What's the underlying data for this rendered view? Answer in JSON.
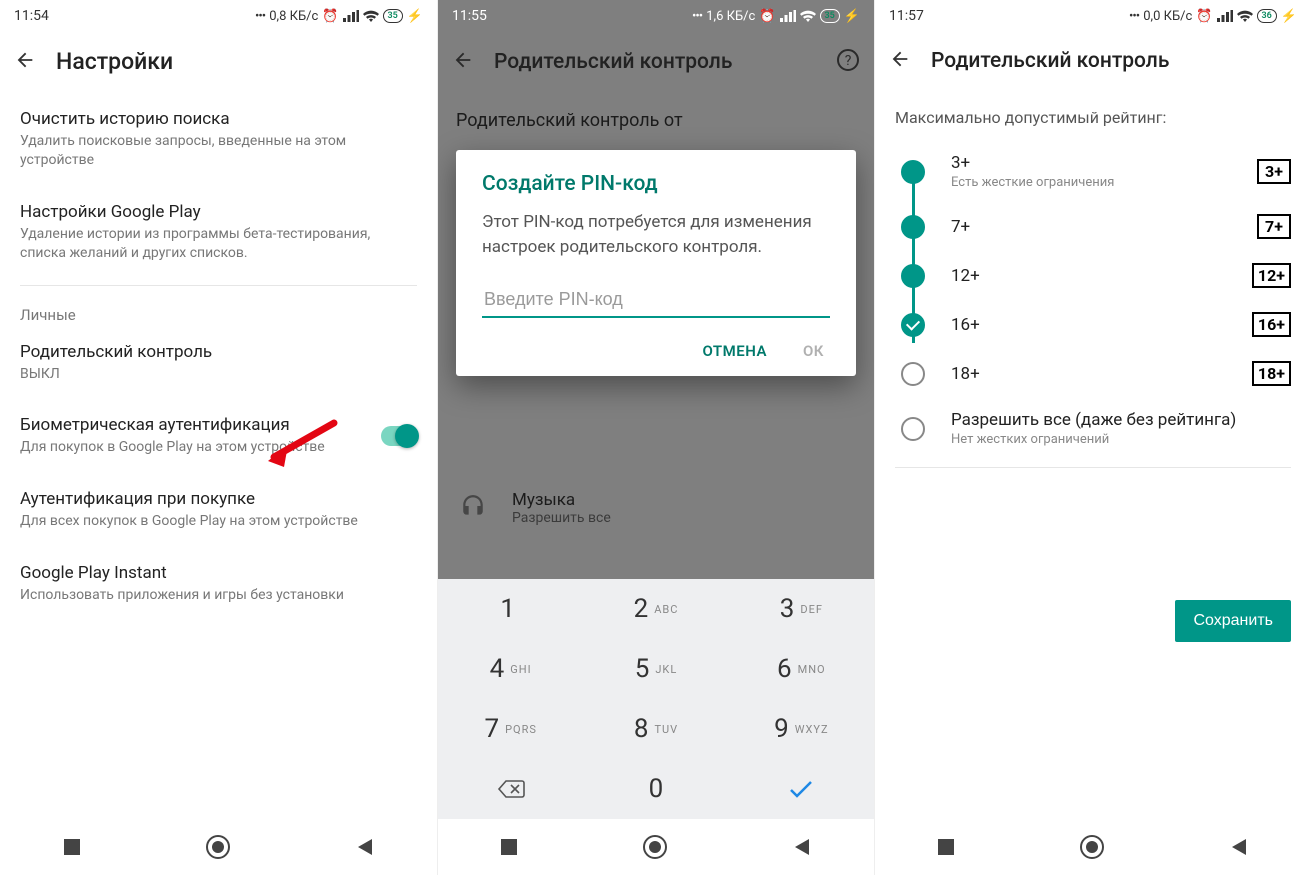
{
  "phone1": {
    "time": "11:54",
    "net": "0,8 КБ/с",
    "battery": "35",
    "title": "Настройки",
    "item1": {
      "title": "Очистить историю поиска",
      "sub": "Удалить поисковые запросы, введенные на этом устройстве"
    },
    "item2": {
      "title": "Настройки Google Play",
      "sub": "Удаление истории из программы бета-тестирования, списка желаний и других списков."
    },
    "sectionLabel": "Личные",
    "item3": {
      "title": "Родительский контроль",
      "sub": "ВЫКЛ"
    },
    "item4": {
      "title": "Биометрическая аутентификация",
      "sub": "Для покупок в Google Play на этом устройстве"
    },
    "item5": {
      "title": "Аутентификация при покупке",
      "sub": "Для всех покупок в Google Play на этом устройстве"
    },
    "item6": {
      "title": "Google Play Instant",
      "sub": "Использовать приложения и игры без установки"
    }
  },
  "phone2": {
    "time": "11:55",
    "net": "1,6 КБ/с",
    "battery": "35",
    "title": "Родительский контроль",
    "bgToggleLabel": "Родительский контроль от",
    "musicTitle": "Музыка",
    "musicSub": "Разрешить все",
    "dialog": {
      "title": "Создайте PIN-код",
      "text": "Этот PIN-код потребуется для изменения настроек родительского контроля.",
      "placeholder": "Введите PIN-код",
      "cancel": "ОТМЕНА",
      "ok": "ОК"
    },
    "keypad": [
      {
        "d": "1",
        "l": ""
      },
      {
        "d": "2",
        "l": "ABC"
      },
      {
        "d": "3",
        "l": "DEF"
      },
      {
        "d": "4",
        "l": "GHI"
      },
      {
        "d": "5",
        "l": "JKL"
      },
      {
        "d": "6",
        "l": "MNO"
      },
      {
        "d": "7",
        "l": "PQRS"
      },
      {
        "d": "8",
        "l": "TUV"
      },
      {
        "d": "9",
        "l": "WXYZ"
      }
    ],
    "zero": "0"
  },
  "phone3": {
    "time": "11:57",
    "net": "0,0 КБ/с",
    "battery": "36",
    "title": "Родительский контроль",
    "heading": "Максимально допустимый рейтинг:",
    "ratings": [
      {
        "label": "3+",
        "sub": "Есть жесткие ограничения",
        "badge": "3+",
        "state": "filled"
      },
      {
        "label": "7+",
        "sub": "",
        "badge": "7+",
        "state": "filled"
      },
      {
        "label": "12+",
        "sub": "",
        "badge": "12+",
        "state": "filled"
      },
      {
        "label": "16+",
        "sub": "",
        "badge": "16+",
        "state": "checked"
      },
      {
        "label": "18+",
        "sub": "",
        "badge": "18+",
        "state": "empty"
      },
      {
        "label": "Разрешить все (даже без рейтинга)",
        "sub": "Нет жестких ограничений",
        "badge": "",
        "state": "empty"
      }
    ],
    "save": "Сохранить"
  }
}
